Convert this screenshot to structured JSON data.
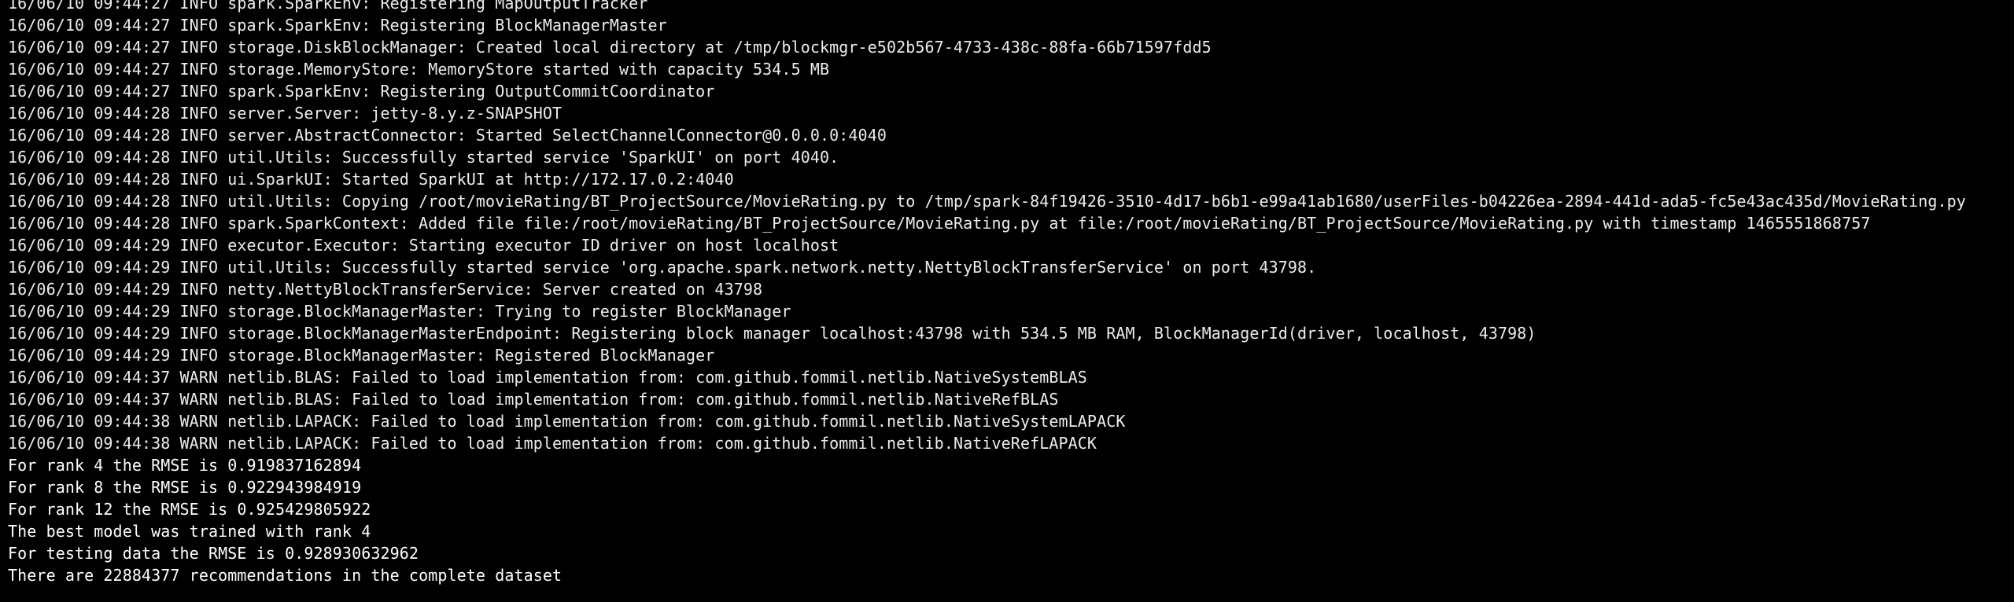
{
  "terminal": {
    "background": "#000000",
    "foreground": "#ececec",
    "partial_top_line": "16/06/10 09:44:27 INFO spark.SparkEnv: Registering MapOutputTracker",
    "lines": [
      "16/06/10 09:44:27 INFO spark.SparkEnv: Registering MapOutputTracker",
      "16/06/10 09:44:27 INFO spark.SparkEnv: Registering BlockManagerMaster",
      "16/06/10 09:44:27 INFO storage.DiskBlockManager: Created local directory at /tmp/blockmgr-e502b567-4733-438c-88fa-66b71597fdd5",
      "16/06/10 09:44:27 INFO storage.MemoryStore: MemoryStore started with capacity 534.5 MB",
      "16/06/10 09:44:27 INFO spark.SparkEnv: Registering OutputCommitCoordinator",
      "16/06/10 09:44:28 INFO server.Server: jetty-8.y.z-SNAPSHOT",
      "16/06/10 09:44:28 INFO server.AbstractConnector: Started SelectChannelConnector@0.0.0.0:4040",
      "16/06/10 09:44:28 INFO util.Utils: Successfully started service 'SparkUI' on port 4040.",
      "16/06/10 09:44:28 INFO ui.SparkUI: Started SparkUI at http://172.17.0.2:4040",
      "16/06/10 09:44:28 INFO util.Utils: Copying /root/movieRating/BT_ProjectSource/MovieRating.py to /tmp/spark-84f19426-3510-4d17-b6b1-e99a41ab1680/userFiles-b04226ea-2894-441d-ada5-fc5e43ac435d/MovieRating.py",
      "16/06/10 09:44:28 INFO spark.SparkContext: Added file file:/root/movieRating/BT_ProjectSource/MovieRating.py at file:/root/movieRating/BT_ProjectSource/MovieRating.py with timestamp 1465551868757",
      "16/06/10 09:44:29 INFO executor.Executor: Starting executor ID driver on host localhost",
      "16/06/10 09:44:29 INFO util.Utils: Successfully started service 'org.apache.spark.network.netty.NettyBlockTransferService' on port 43798.",
      "16/06/10 09:44:29 INFO netty.NettyBlockTransferService: Server created on 43798",
      "16/06/10 09:44:29 INFO storage.BlockManagerMaster: Trying to register BlockManager",
      "16/06/10 09:44:29 INFO storage.BlockManagerMasterEndpoint: Registering block manager localhost:43798 with 534.5 MB RAM, BlockManagerId(driver, localhost, 43798)",
      "16/06/10 09:44:29 INFO storage.BlockManagerMaster: Registered BlockManager",
      "16/06/10 09:44:37 WARN netlib.BLAS: Failed to load implementation from: com.github.fommil.netlib.NativeSystemBLAS",
      "16/06/10 09:44:37 WARN netlib.BLAS: Failed to load implementation from: com.github.fommil.netlib.NativeRefBLAS",
      "16/06/10 09:44:38 WARN netlib.LAPACK: Failed to load implementation from: com.github.fommil.netlib.NativeSystemLAPACK",
      "16/06/10 09:44:38 WARN netlib.LAPACK: Failed to load implementation from: com.github.fommil.netlib.NativeRefLAPACK",
      "For rank 4 the RMSE is 0.919837162894",
      "For rank 8 the RMSE is 0.922943984919",
      "For rank 12 the RMSE is 0.925429805922",
      "The best model was trained with rank 4",
      "For testing data the RMSE is 0.928930632962",
      "There are 22884377 recommendations in the complete dataset"
    ]
  }
}
